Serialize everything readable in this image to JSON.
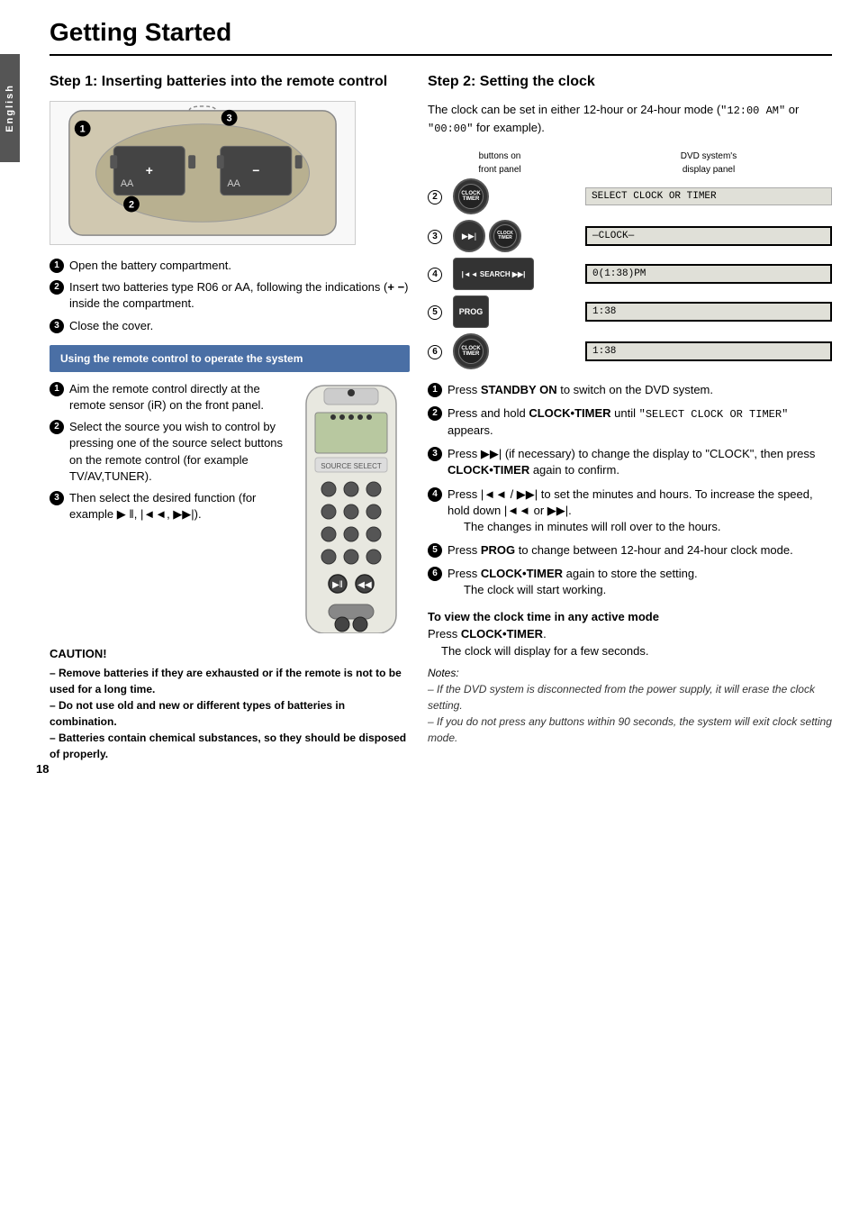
{
  "page": {
    "title": "Getting Started",
    "page_number": "18",
    "language_tab": "English"
  },
  "step1": {
    "heading": "Step 1:   Inserting batteries into the remote control",
    "steps": [
      "Open the battery compartment.",
      "Insert two batteries type R06 or AA, following the indications (+ −) inside the compartment.",
      "Close the cover."
    ],
    "blue_box": {
      "title": "Using the remote control to operate the system"
    },
    "remote_steps": [
      "Aim the remote control directly at the remote sensor (iR) on the front panel.",
      "Select the source you wish to control by pressing one of the source select buttons on the remote control (for example TV/AV,TUNER).",
      "Then select the desired function (for example ▶ ‖, |◄◄, ▶▶|)."
    ],
    "caution": {
      "title": "CAUTION!",
      "lines": [
        "– Remove batteries if they are exhausted or if the remote is not to be used for a long time.",
        "– Do not use old and new or different types of batteries in combination.",
        "– Batteries contain chemical substances, so they should be disposed of properly."
      ]
    }
  },
  "step2": {
    "heading": "Step 2:   Setting the clock",
    "intro": "The clock can be set in either 12-hour or 24-hour mode (\"12:00 AM\" or \"00:00\" for example).",
    "diagram": {
      "left_label": "buttons on\nfront panel",
      "right_label": "DVD system's\ndisplay panel",
      "rows": [
        {
          "step": "2",
          "button": "CLOCK-TIMER",
          "display": "SELECT CLOCK OR TIMER"
        },
        {
          "step": "3",
          "button": "▶▶| CLOCK-TIMER",
          "display": "—CLOCK—"
        },
        {
          "step": "4",
          "button": "|◄◄ SEARCH ▶▶|",
          "display": "0(1:38)PM"
        },
        {
          "step": "5",
          "button": "PROG",
          "display": "1:38"
        },
        {
          "step": "6",
          "button": "CLOCK-TIMER",
          "display": "1:38"
        }
      ]
    },
    "instructions": [
      {
        "num": "1",
        "text": "Press STANDBY ON to switch on the DVD system."
      },
      {
        "num": "2",
        "text": "Press and hold CLOCK•TIMER until \"SELECT CLOCK OR TIMER\" appears."
      },
      {
        "num": "3",
        "text": "Press ▶▶| (if necessary) to change the display to \"CLOCK\", then press CLOCK•TIMER again to confirm."
      },
      {
        "num": "4",
        "text": "Press |◄◄ / ▶▶| to set the minutes and hours. To increase the speed, hold down |◄◄ or ▶▶|. The changes in minutes will roll over to the hours."
      },
      {
        "num": "5",
        "text": "Press PROG to change between 12-hour and 24-hour clock mode."
      },
      {
        "num": "6",
        "text": "Press CLOCK•TIMER again to store the setting. The clock will start working."
      }
    ],
    "view_clock": {
      "subheading": "To view the clock time in any active mode",
      "text": "Press CLOCK•TIMER.",
      "subtext": "The clock will display for a few seconds."
    },
    "notes": {
      "title": "Notes:",
      "lines": [
        "– If the DVD system is disconnected from the power supply, it will erase the clock setting.",
        "– If you do not press any buttons within 90 seconds, the system will exit clock setting mode."
      ]
    }
  }
}
